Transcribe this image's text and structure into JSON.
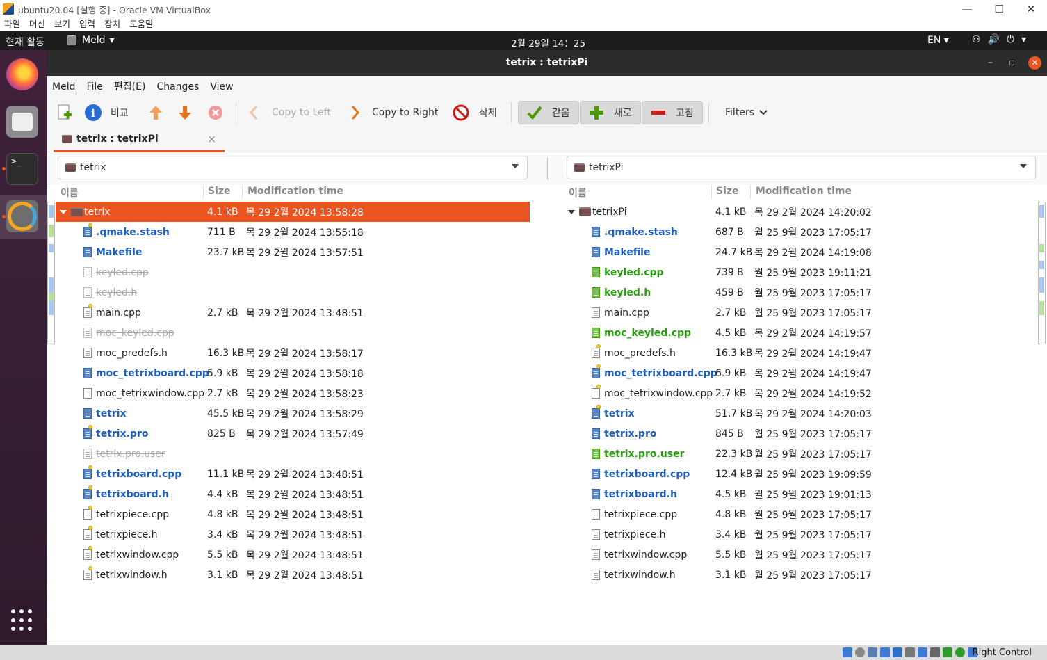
{
  "vbox": {
    "title": "ubuntu20.04 [실행 중] - Oracle VM VirtualBox",
    "menu": [
      "파일",
      "머신",
      "보기",
      "입력",
      "장치",
      "도움말"
    ],
    "min": "—",
    "max": "☐",
    "close": "✕",
    "host_key": "Right Control"
  },
  "gnome": {
    "activities": "현재 활동",
    "app_name": "Meld",
    "app_arrow": "▾",
    "clock": "2월 29일  14：25",
    "lang": "EN ▾",
    "tray": [
      "⚇",
      "🔊",
      "⏻",
      "▾"
    ]
  },
  "dock": {
    "terminal_glyph": ">_"
  },
  "window": {
    "title": "tetrix : tetrixPi",
    "minimize": "–",
    "maximize": "▫",
    "close": "✕"
  },
  "menu": [
    "Meld",
    "File",
    "편집(E)",
    "Changes",
    "View"
  ],
  "toolbar": {
    "compare": "비교",
    "copy_left": "Copy to Left",
    "copy_right": "Copy to Right",
    "delete": "삭제",
    "same": "같음",
    "new": "새로",
    "modified": "고침",
    "filters": "Filters"
  },
  "tab": {
    "label": "tetrix : tetrixPi",
    "close": "×"
  },
  "left": {
    "path": "tetrix",
    "headers": {
      "name": "이름",
      "size": "Size",
      "mtime": "Modification time"
    },
    "rows": [
      {
        "name": "tetrix",
        "size": "4.1 kB",
        "mtime": "목 29  2월 2024 13:58:28",
        "state": "dir",
        "selected": true
      },
      {
        "name": ".qmake.stash",
        "size": "711 B",
        "mtime": "목 29  2월 2024 13:55:18",
        "state": "mod",
        "star": true
      },
      {
        "name": "Makefile",
        "size": "23.7 kB",
        "mtime": "목 29  2월 2024 13:57:51",
        "state": "mod"
      },
      {
        "name": "keyled.cpp",
        "size": "",
        "mtime": "",
        "state": "miss"
      },
      {
        "name": "keyled.h",
        "size": "",
        "mtime": "",
        "state": "miss"
      },
      {
        "name": "main.cpp",
        "size": "2.7 kB",
        "mtime": "목 29  2월 2024 13:48:51",
        "state": "norm",
        "star": true
      },
      {
        "name": "moc_keyled.cpp",
        "size": "",
        "mtime": "",
        "state": "miss"
      },
      {
        "name": "moc_predefs.h",
        "size": "16.3 kB",
        "mtime": "목 29  2월 2024 13:58:17",
        "state": "norm"
      },
      {
        "name": "moc_tetrixboard.cpp",
        "size": "5.9 kB",
        "mtime": "목 29  2월 2024 13:58:18",
        "state": "mod"
      },
      {
        "name": "moc_tetrixwindow.cpp",
        "size": "2.7 kB",
        "mtime": "목 29  2월 2024 13:58:23",
        "state": "norm"
      },
      {
        "name": "tetrix",
        "size": "45.5 kB",
        "mtime": "목 29  2월 2024 13:58:29",
        "state": "mod"
      },
      {
        "name": "tetrix.pro",
        "size": "825 B",
        "mtime": "목 29  2월 2024 13:57:49",
        "state": "mod",
        "star": true
      },
      {
        "name": "tetrix.pro.user",
        "size": "",
        "mtime": "",
        "state": "miss"
      },
      {
        "name": "tetrixboard.cpp",
        "size": "11.1 kB",
        "mtime": "목 29  2월 2024 13:48:51",
        "state": "mod",
        "star": true
      },
      {
        "name": "tetrixboard.h",
        "size": "4.4 kB",
        "mtime": "목 29  2월 2024 13:48:51",
        "state": "mod",
        "star": true
      },
      {
        "name": "tetrixpiece.cpp",
        "size": "4.8 kB",
        "mtime": "목 29  2월 2024 13:48:51",
        "state": "norm",
        "star": true
      },
      {
        "name": "tetrixpiece.h",
        "size": "3.4 kB",
        "mtime": "목 29  2월 2024 13:48:51",
        "state": "norm",
        "star": true
      },
      {
        "name": "tetrixwindow.cpp",
        "size": "5.5 kB",
        "mtime": "목 29  2월 2024 13:48:51",
        "state": "norm",
        "star": true
      },
      {
        "name": "tetrixwindow.h",
        "size": "3.1 kB",
        "mtime": "목 29  2월 2024 13:48:51",
        "state": "norm",
        "star": true
      }
    ]
  },
  "right": {
    "path": "tetrixPi",
    "headers": {
      "name": "이름",
      "size": "Size",
      "mtime": "Modification time"
    },
    "rows": [
      {
        "name": "tetrixPi",
        "size": "4.1 kB",
        "mtime": "목 29  2월 2024 14:20:02",
        "state": "dir"
      },
      {
        "name": ".qmake.stash",
        "size": "687 B",
        "mtime": "월 25  9월 2023 17:05:17",
        "state": "mod"
      },
      {
        "name": "Makefile",
        "size": "24.7 kB",
        "mtime": "목 29  2월 2024 14:19:08",
        "state": "mod"
      },
      {
        "name": "keyled.cpp",
        "size": "739 B",
        "mtime": "월 25  9월 2023 19:11:21",
        "state": "new"
      },
      {
        "name": "keyled.h",
        "size": "459 B",
        "mtime": "월 25  9월 2023 17:05:17",
        "state": "new"
      },
      {
        "name": "main.cpp",
        "size": "2.7 kB",
        "mtime": "월 25  9월 2023 17:05:17",
        "state": "norm"
      },
      {
        "name": "moc_keyled.cpp",
        "size": "4.5 kB",
        "mtime": "목 29  2월 2024 14:19:57",
        "state": "new"
      },
      {
        "name": "moc_predefs.h",
        "size": "16.3 kB",
        "mtime": "목 29  2월 2024 14:19:47",
        "state": "norm",
        "star": true
      },
      {
        "name": "moc_tetrixboard.cpp",
        "size": "6.9 kB",
        "mtime": "목 29  2월 2024 14:19:47",
        "state": "mod",
        "star": true
      },
      {
        "name": "moc_tetrixwindow.cpp",
        "size": "2.7 kB",
        "mtime": "목 29  2월 2024 14:19:52",
        "state": "norm",
        "star": true
      },
      {
        "name": "tetrix",
        "size": "51.7 kB",
        "mtime": "목 29  2월 2024 14:20:03",
        "state": "mod",
        "star": true
      },
      {
        "name": "tetrix.pro",
        "size": "845 B",
        "mtime": "월 25  9월 2023 17:05:17",
        "state": "mod"
      },
      {
        "name": "tetrix.pro.user",
        "size": "22.3 kB",
        "mtime": "월 25  9월 2023 17:05:17",
        "state": "new"
      },
      {
        "name": "tetrixboard.cpp",
        "size": "12.4 kB",
        "mtime": "월 25  9월 2023 19:09:59",
        "state": "mod"
      },
      {
        "name": "tetrixboard.h",
        "size": "4.5 kB",
        "mtime": "월 25  9월 2023 19:01:13",
        "state": "mod"
      },
      {
        "name": "tetrixpiece.cpp",
        "size": "4.8 kB",
        "mtime": "월 25  9월 2023 17:05:17",
        "state": "norm"
      },
      {
        "name": "tetrixpiece.h",
        "size": "3.4 kB",
        "mtime": "월 25  9월 2023 17:05:17",
        "state": "norm"
      },
      {
        "name": "tetrixwindow.cpp",
        "size": "5.5 kB",
        "mtime": "월 25  9월 2023 17:05:17",
        "state": "norm"
      },
      {
        "name": "tetrixwindow.h",
        "size": "3.1 kB",
        "mtime": "월 25  9월 2023 17:05:17",
        "state": "norm"
      }
    ]
  },
  "colors": {
    "accent": "#e95420",
    "modified": "#1f5fbf",
    "new": "#27a00c",
    "missing": "#a8a8a8",
    "map_mod": "#a9c6ec",
    "map_new": "#b7e19a"
  }
}
